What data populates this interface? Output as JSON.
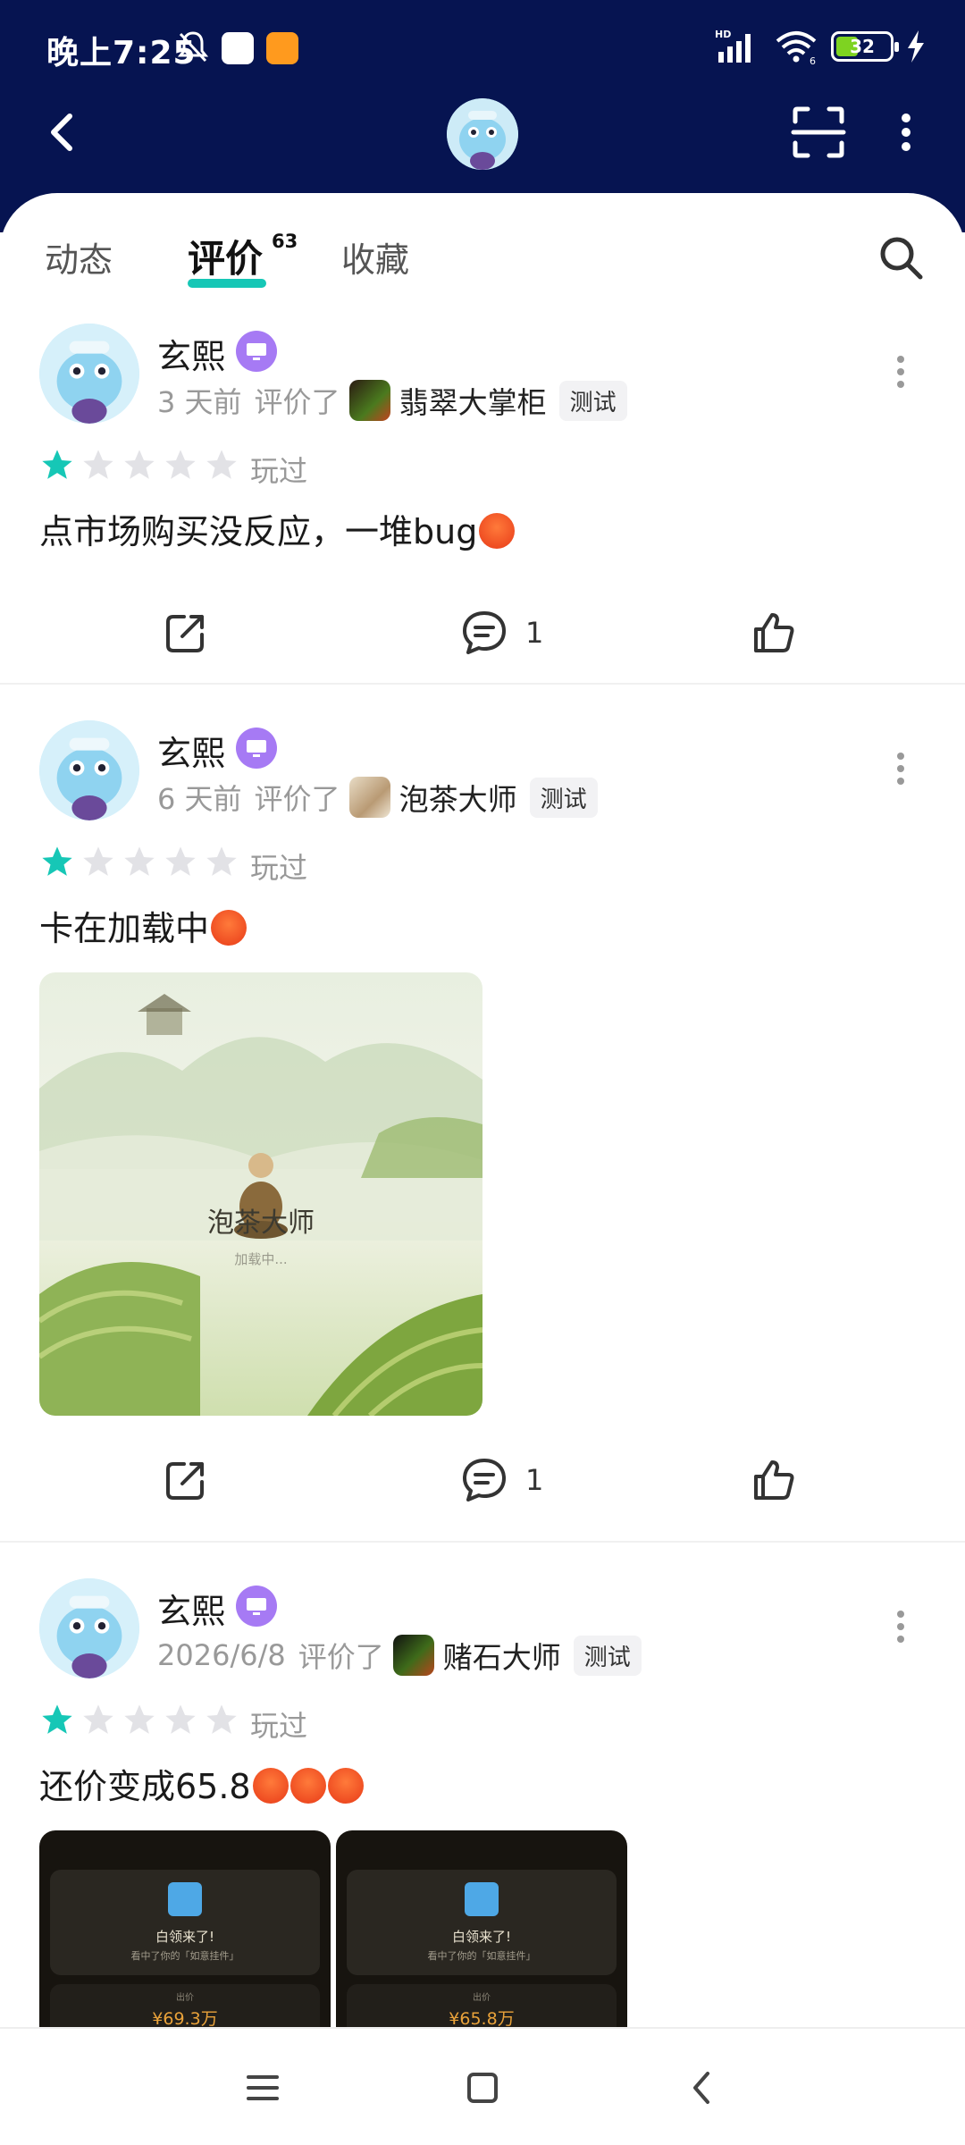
{
  "status_bar": {
    "time": "晚上7:25",
    "network": "HD",
    "wifi_sub": "6",
    "battery": "32"
  },
  "header": {
    "back_icon": "chevron-left-icon",
    "scan_icon": "scan-icon",
    "more_icon": "more-vertical-icon"
  },
  "tabs": [
    {
      "label": "动态"
    },
    {
      "label": "评价",
      "count": "63",
      "active": true
    },
    {
      "label": "收藏"
    }
  ],
  "colors": {
    "header_bg": "#061451",
    "accent": "#16c7b6",
    "badge": "#a67af4"
  },
  "reviews": [
    {
      "user": "玄熙",
      "time": "3 天前",
      "action": "评价了",
      "game": "翡翠大掌柜",
      "tag": "测试",
      "rating": 1,
      "rating_max": 5,
      "played": "玩过",
      "text": "点市场购买没反应，一堆bug",
      "comments": "1"
    },
    {
      "user": "玄熙",
      "time": "6 天前",
      "action": "评价了",
      "game": "泡茶大师",
      "tag": "测试",
      "rating": 1,
      "rating_max": 5,
      "played": "玩过",
      "text": "卡在加载中",
      "image_title": "泡茶大师",
      "image_sub": "加载中...",
      "comments": "1"
    },
    {
      "user": "玄熙",
      "time": "2026/6/8",
      "action": "评价了",
      "game": "赌石大师",
      "tag": "测试",
      "rating": 1,
      "rating_max": 5,
      "played": "玩过",
      "text": "还价变成65.8",
      "shots": [
        {
          "title": "白领来了!",
          "sub": "看中了你的「如意挂件」",
          "label": "出价",
          "price": "¥69.3万"
        },
        {
          "title": "白领来了!",
          "sub": "看中了你的「如意挂件」",
          "label": "出价",
          "price": "¥65.8万"
        }
      ]
    }
  ]
}
